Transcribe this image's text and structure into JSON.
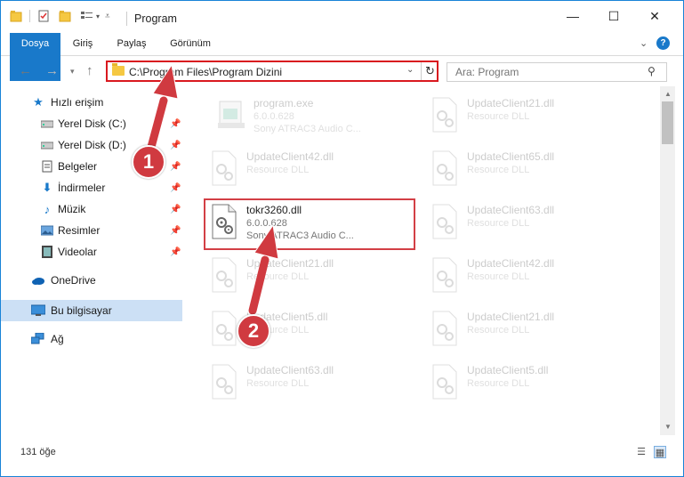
{
  "window": {
    "title": "Program"
  },
  "window_controls": {
    "minimize": "—",
    "maximize": "☐",
    "close": "✕"
  },
  "ribbon": {
    "tabs": [
      "Dosya",
      "Giriş",
      "Paylaş",
      "Görünüm"
    ]
  },
  "address": {
    "path": "C:\\Program Files\\Program Dizini"
  },
  "search": {
    "placeholder": "Ara: Program"
  },
  "sidebar": {
    "items": [
      {
        "label": "Hızlı erişim",
        "icon": "star-icon",
        "pinned": false
      },
      {
        "label": "Yerel Disk (C:)",
        "icon": "drive-icon",
        "pinned": true
      },
      {
        "label": "Yerel Disk (D:)",
        "icon": "drive-icon",
        "pinned": true
      },
      {
        "label": "Belgeler",
        "icon": "document-icon",
        "pinned": true
      },
      {
        "label": "İndirmeler",
        "icon": "download-icon",
        "pinned": true
      },
      {
        "label": "Müzik",
        "icon": "music-icon",
        "pinned": true
      },
      {
        "label": "Resimler",
        "icon": "pictures-icon",
        "pinned": true
      },
      {
        "label": "Videolar",
        "icon": "video-icon",
        "pinned": true
      },
      {
        "label": "OneDrive",
        "icon": "cloud-icon",
        "pinned": false
      },
      {
        "label": "Bu bilgisayar",
        "icon": "computer-icon",
        "pinned": false,
        "selected": true
      },
      {
        "label": "Ağ",
        "icon": "network-icon",
        "pinned": false
      }
    ]
  },
  "files": {
    "left": [
      {
        "name": "program.exe",
        "line2": "6.0.0.628",
        "line3": "Sony ATRAC3 Audio C...",
        "type": "exe"
      },
      {
        "name": "UpdateClient42.dll",
        "line2": "Resource DLL",
        "line3": "",
        "type": "dll"
      },
      {
        "name": "tokr3260.dll",
        "line2": "6.0.0.628",
        "line3": "Sony ATRAC3 Audio C...",
        "type": "dll",
        "highlighted": true
      },
      {
        "name": "UpdateClient21.dll",
        "line2": "Resource DLL",
        "line3": "",
        "type": "dll"
      },
      {
        "name": "UpdateClient5.dll",
        "line2": "Resource DLL",
        "line3": "",
        "type": "dll"
      },
      {
        "name": "UpdateClient63.dll",
        "line2": "Resource DLL",
        "line3": "",
        "type": "dll"
      }
    ],
    "right": [
      {
        "name": "UpdateClient21.dll",
        "line2": "Resource DLL",
        "type": "dll"
      },
      {
        "name": "UpdateClient65.dll",
        "line2": "Resource DLL",
        "type": "dll"
      },
      {
        "name": "UpdateClient63.dll",
        "line2": "Resource DLL",
        "type": "dll"
      },
      {
        "name": "UpdateClient42.dll",
        "line2": "Resource DLL",
        "type": "dll"
      },
      {
        "name": "UpdateClient21.dll",
        "line2": "Resource DLL",
        "type": "dll"
      },
      {
        "name": "UpdateClient5.dll",
        "line2": "Resource DLL",
        "type": "dll"
      }
    ]
  },
  "status": {
    "item_count": "131 öğe"
  },
  "annotations": {
    "step1": "1",
    "step2": "2",
    "accent_color": "#d03a40"
  }
}
